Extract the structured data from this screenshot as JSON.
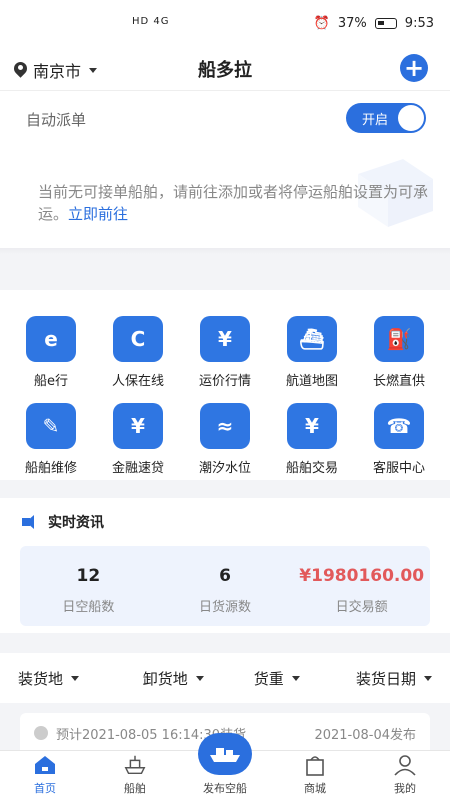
{
  "status_bar": {
    "network": "HD 4G",
    "battery": "37%",
    "time": "9:53"
  },
  "header": {
    "city": "南京市",
    "title": "船多拉"
  },
  "dispatch": {
    "label": "自动派单",
    "toggle_text": "开启",
    "message": "当前无可接单船舶，请前往添加或者将停运船舶设置为可承运。",
    "link": "立即前往"
  },
  "grid": [
    {
      "label": "船e行",
      "icon": "e"
    },
    {
      "label": "人保在线",
      "icon": "C"
    },
    {
      "label": "运价行情",
      "icon": "¥"
    },
    {
      "label": "航道地图",
      "icon": "⛴"
    },
    {
      "label": "长燃直供",
      "icon": "⛽"
    },
    {
      "label": "船舶维修",
      "icon": "🔧"
    },
    {
      "label": "金融速贷",
      "icon": "¥"
    },
    {
      "label": "潮汐水位",
      "icon": "≈"
    },
    {
      "label": "船舶交易",
      "icon": "¥"
    },
    {
      "label": "客服中心",
      "icon": "☎"
    }
  ],
  "news": {
    "title": "实时资讯",
    "stats": [
      {
        "value": "12",
        "label": "日空船数"
      },
      {
        "value": "6",
        "label": "日货源数"
      },
      {
        "value": "¥1980160.00",
        "label": "日交易额"
      }
    ]
  },
  "filters": [
    "装货地",
    "卸货地",
    "货重",
    "装货日期"
  ],
  "listing": {
    "left": "预计2021-08-05 16:14:30装货",
    "right": "2021-08-04发布"
  },
  "nav": [
    {
      "label": "首页"
    },
    {
      "label": "船舶"
    },
    {
      "label": "发布空船"
    },
    {
      "label": "商城"
    },
    {
      "label": "我的"
    }
  ],
  "colors": {
    "accent": "#2b6fde",
    "money": "#e2595b"
  }
}
